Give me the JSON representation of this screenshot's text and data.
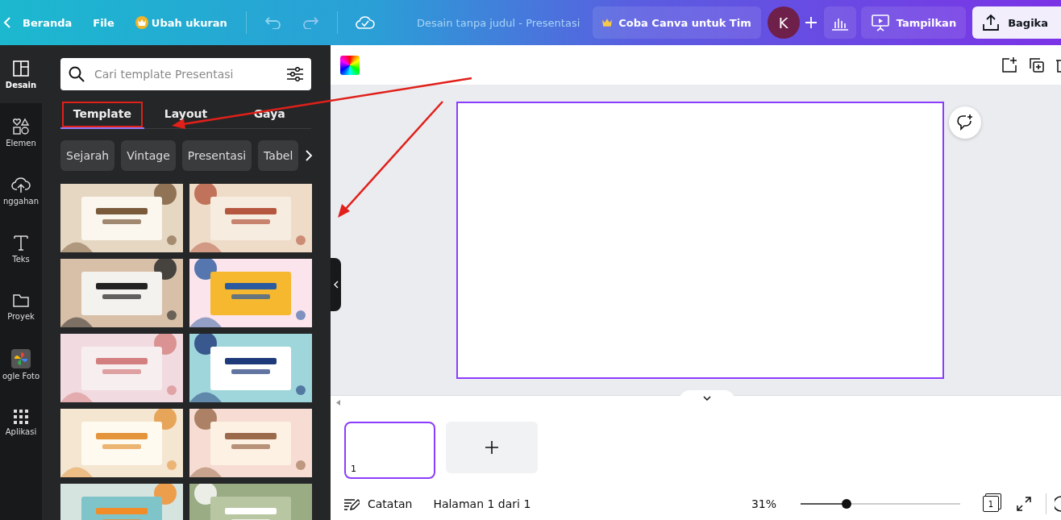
{
  "topbar": {
    "back": "Beranda",
    "file": "File",
    "resize": "Ubah ukuran",
    "title": "Desain tanpa judul - Presentasi",
    "team": "Coba Canva untuk Tim",
    "avatar": "K",
    "present": "Tampilkan",
    "share": "Bagika"
  },
  "rail": [
    {
      "label": "Desain",
      "selected": true
    },
    {
      "label": "Elemen",
      "selected": false
    },
    {
      "label": "nggahan",
      "selected": false
    },
    {
      "label": "Teks",
      "selected": false
    },
    {
      "label": "Proyek",
      "selected": false
    },
    {
      "label": "ogle Foto",
      "selected": false
    },
    {
      "label": "Aplikasi",
      "selected": false
    }
  ],
  "panel": {
    "search": {
      "placeholder": "Cari template Presentasi"
    },
    "tabs": [
      {
        "label": "Template",
        "selected": true,
        "highlighted": true
      },
      {
        "label": "Layout",
        "selected": false,
        "highlighted": false
      },
      {
        "label": "Gaya",
        "selected": false,
        "highlighted": false
      }
    ],
    "chips": [
      "Sejarah",
      "Vintage",
      "Presentasi",
      "Tabel"
    ]
  },
  "pages": [
    {
      "number": "1",
      "selected": true
    }
  ],
  "status_bar": {
    "notes": "Catatan",
    "page_info": "Halaman 1 dari 1",
    "zoom": "31%",
    "zoom_slider": {
      "level": 0.29
    },
    "page_count": "1"
  }
}
